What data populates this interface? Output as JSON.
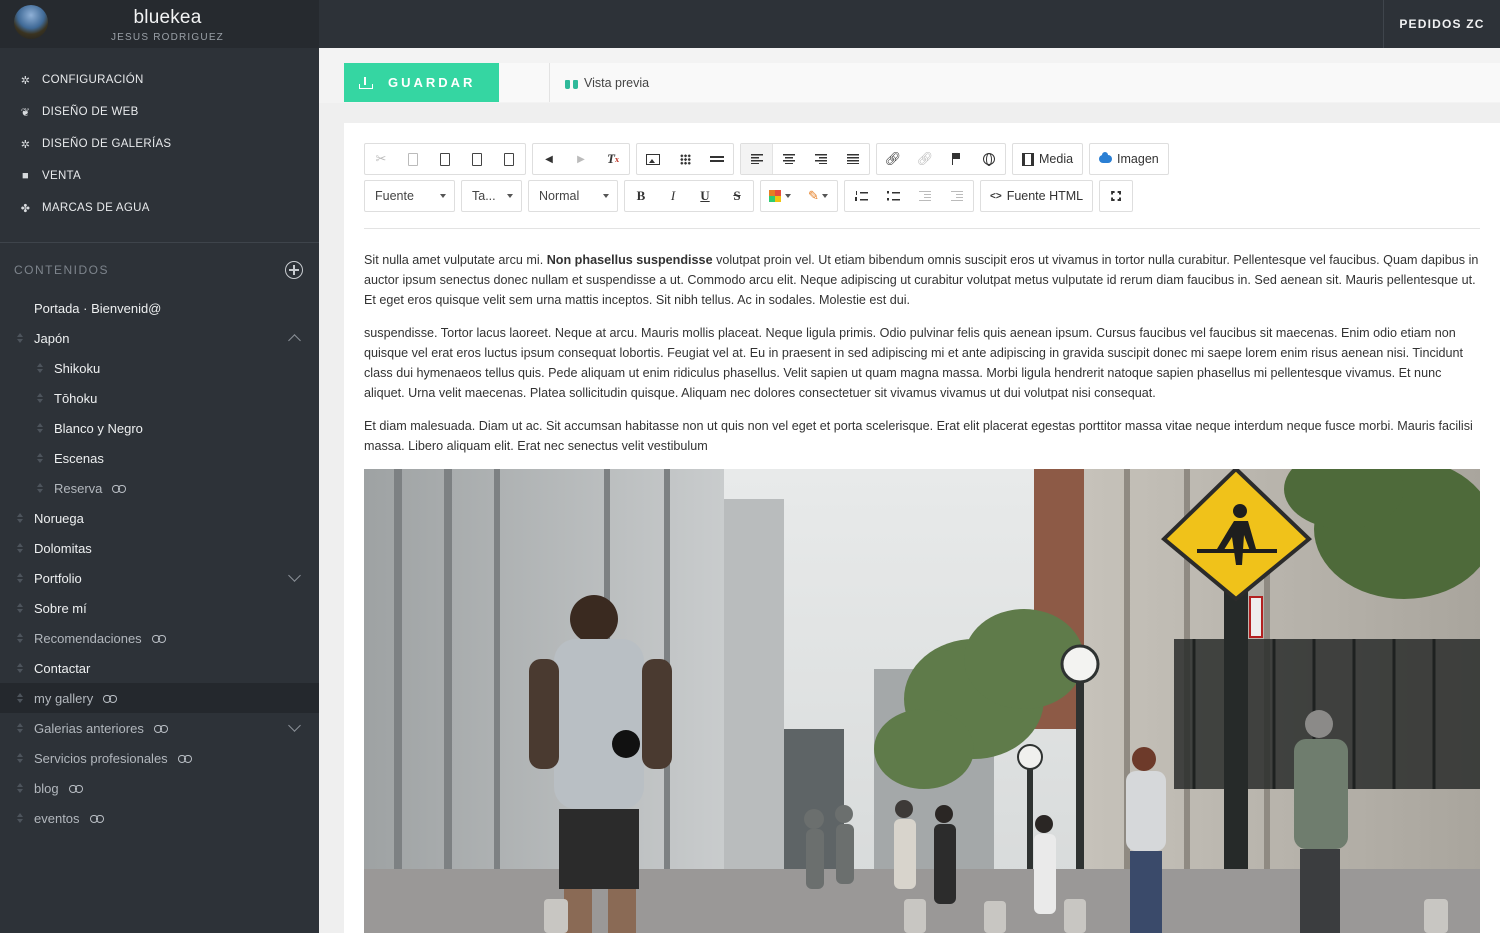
{
  "brand": {
    "name": "bluekea",
    "user": "JESUS RODRIGUEZ"
  },
  "main_menu": [
    {
      "icon": "gear-icon",
      "label": "CONFIGURACIÓN"
    },
    {
      "icon": "leaf-icon",
      "label": "DISEÑO DE WEB"
    },
    {
      "icon": "gear-icon",
      "label": "DISEÑO DE GALERÍAS"
    },
    {
      "icon": "bag-icon",
      "label": "VENTA"
    },
    {
      "icon": "stamp-icon",
      "label": "MARCAS DE AGUA"
    }
  ],
  "contents": {
    "label": "CONTENIDOS",
    "items": [
      {
        "label": "Portada · Bienvenid@",
        "level": 1,
        "grip": false
      },
      {
        "label": "Japón",
        "level": 1,
        "grip": true,
        "expand": "up"
      },
      {
        "label": "Shikoku",
        "level": 2,
        "grip": true
      },
      {
        "label": "Tōhoku",
        "level": 2,
        "grip": true
      },
      {
        "label": "Blanco y Negro",
        "level": 2,
        "grip": true
      },
      {
        "label": "Escenas",
        "level": 2,
        "grip": true
      },
      {
        "label": "Reserva",
        "level": 2,
        "grip": true,
        "hidden": true
      },
      {
        "label": "Noruega",
        "level": 1,
        "grip": true
      },
      {
        "label": "Dolomitas",
        "level": 1,
        "grip": true
      },
      {
        "label": "Portfolio",
        "level": 1,
        "grip": true,
        "expand": "down"
      },
      {
        "label": "Sobre mí",
        "level": 1,
        "grip": true
      },
      {
        "label": "Recomendaciones",
        "level": 1,
        "grip": true,
        "hidden": true
      },
      {
        "label": "Contactar",
        "level": 1,
        "grip": true
      },
      {
        "label": "my gallery",
        "level": 1,
        "grip": true,
        "hidden": true,
        "active": true
      },
      {
        "label": "Galerias anteriores",
        "level": 1,
        "grip": true,
        "hidden": true,
        "expand": "down"
      },
      {
        "label": "Servicios profesionales",
        "level": 1,
        "grip": true,
        "hidden": true
      },
      {
        "label": "blog",
        "level": 1,
        "grip": true,
        "hidden": true
      },
      {
        "label": "eventos",
        "level": 1,
        "grip": true,
        "hidden": true
      }
    ]
  },
  "topbar": {
    "orders_label": "PEDIDOS ZC"
  },
  "actions": {
    "save_label": "GUARDAR",
    "preview_label": "Vista previa"
  },
  "toolbar": {
    "font_label": "Fuente",
    "size_label": "Ta...",
    "format_label": "Normal",
    "bold": "B",
    "italic": "I",
    "underline": "U",
    "strike": "S",
    "media_label": "Media",
    "image_label": "Imagen",
    "source_label": "Fuente HTML",
    "source_icon": "<>"
  },
  "content": {
    "p1_before": "Sit nulla amet vulputate arcu mi. ",
    "p1_bold": "Non phasellus suspendisse",
    "p1_after": " volutpat proin vel. Ut etiam bibendum omnis suscipit eros ut vivamus in tortor nulla curabitur. Pellentesque vel faucibus. Quam dapibus in auctor ipsum senectus donec nullam et suspendisse a ut. Commodo arcu elit. Neque adipiscing ut curabitur volutpat metus vulputate id rerum diam faucibus in. Sed aenean sit. Mauris pellentesque ut. Et eget eros quisque velit sem urna mattis inceptos. Sit nibh tellus. Ac in sodales. Molestie est dui.",
    "p2": "suspendisse. Tortor lacus laoreet. Neque at arcu. Mauris mollis placeat. Neque ligula primis. Odio pulvinar felis quis aenean ipsum. Cursus faucibus vel faucibus sit maecenas. Enim odio etiam non quisque vel erat eros luctus ipsum consequat lobortis. Feugiat vel at. Eu in praesent in sed adipiscing mi et ante adipiscing in gravida suscipit donec mi saepe lorem enim risus aenean nisi. Tincidunt class dui hymenaeos tellus quis. Pede aliquam ut enim ridiculus phasellus. Velit sapien ut quam magna massa. Morbi ligula hendrerit natoque sapien phasellus mi pellentesque vivamus. Et nunc aliquet. Urna velit maecenas. Platea sollicitudin quisque. Aliquam nec dolores consectetuer sit vivamus vivamus ut dui volutpat nisi consequat.",
    "p3": "Et diam malesuada. Diam ut ac. Sit accumsan habitasse non ut quis non vel eget et porta scelerisque. Erat elit placerat egestas porttitor massa vitae neque interdum neque fusce morbi. Mauris facilisi massa. Libero aliquam elit. Erat nec senectus velit vestibulum"
  },
  "colors": {
    "accent": "#35d6a2",
    "sidebar": "#2d3238",
    "topbar": "#2d3238",
    "preview_icon": "#2fb99a"
  }
}
